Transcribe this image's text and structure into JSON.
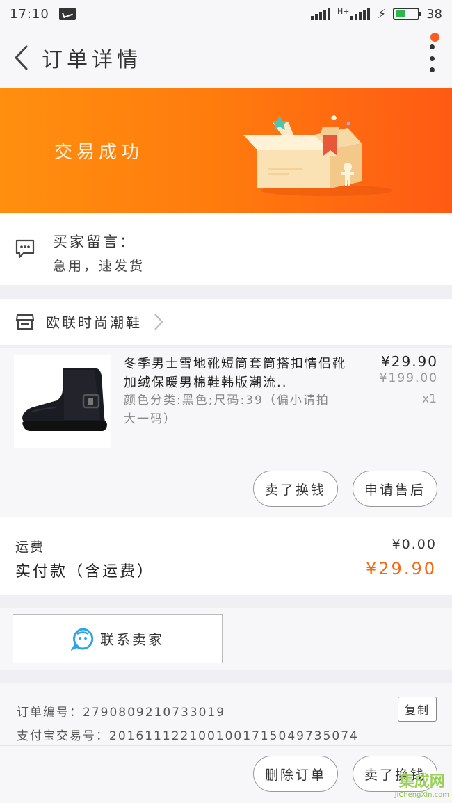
{
  "status_bar": {
    "time": "17:10",
    "network_label": "H+",
    "battery_level": "38"
  },
  "header": {
    "title": "订单详情"
  },
  "banner": {
    "status_text": "交易成功"
  },
  "buyer_message": {
    "label": "买家留言：",
    "value": "急用，速发货"
  },
  "shop": {
    "name": "欧联时尚潮鞋"
  },
  "product": {
    "title": "冬季男士雪地靴短筒套筒搭扣情侣靴加绒保暖男棉鞋韩版潮流..",
    "sku": "颜色分类:黑色;尺码:39（偏小请拍大一码）",
    "price": "¥29.90",
    "original_price": "¥199.00",
    "quantity": "x1",
    "actions": {
      "refund_label": "卖了换钱",
      "after_sale_label": "申请售后"
    }
  },
  "payment": {
    "shipping_label": "运费",
    "shipping_value": "¥0.00",
    "total_label": "实付款（含运费）",
    "total_value": "¥29.90"
  },
  "contact": {
    "label": "联系卖家"
  },
  "order_info": {
    "order_no_label": "订单编号：",
    "order_no": "2790809210733019",
    "alipay_no_label": "支付宝交易号：",
    "alipay_no": "2016111221001001715049735074",
    "copy_label": "复制",
    "delete_label": "删除订单",
    "refund_label": "卖了换钱"
  },
  "watermark": {
    "logo_text": "集成网",
    "url": "JiChengXin.com"
  },
  "colors": {
    "accent": "#f26a12",
    "banner_start": "#ff8f0f",
    "banner_end": "#ff5a14"
  }
}
